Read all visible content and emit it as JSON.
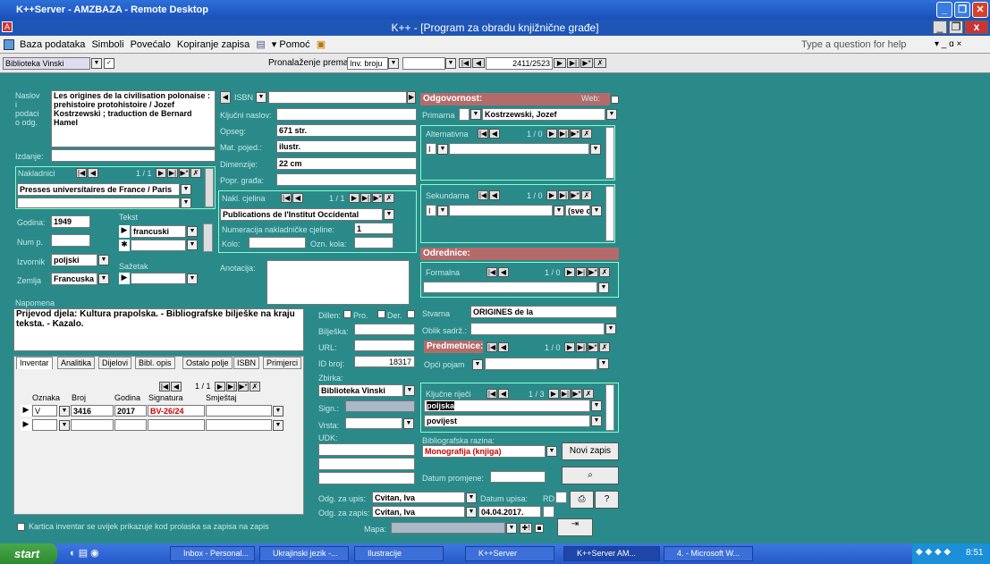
{
  "rdp": {
    "title": "K++Server - AMZBAZA - Remote Desktop"
  },
  "app": {
    "title": "K++ - [Program za obradu knjižnične građe]"
  },
  "menu": {
    "items": [
      "Baza podataka",
      "Simboli",
      "Povećalo",
      "Kopiranje zapisa",
      "▾ Pomoć"
    ],
    "help_placeholder": "Type a question for help"
  },
  "toolbar": {
    "library": "Biblioteka Vinski",
    "search_label": "Pronalaženje prema:",
    "search_by": "Inv. broju",
    "record_counter": "2411/2523"
  },
  "record": {
    "naslov_label": "Naslov i podaci o odg.",
    "naslov": "Les origines de la civilisation polonaise : prehistoire protohistoire / Jozef Kostrzewski ; traduction de Bernard Hamel",
    "izdanje_label": "Izdanje:",
    "nakladnici_label": "Nakladnici",
    "nakladnici_count": "1 / 1",
    "nakladnik": "Presses universitaires de France / Paris",
    "godina_label": "Godina:",
    "godina": "1949",
    "tekst_label": "Tekst",
    "tekst": "francuski",
    "nump_label": "Num p.",
    "izvornik_label": "Izvornik",
    "izvornik": "poljski",
    "sazetak_label": "Sažetak",
    "zemlja_label": "Zemlja",
    "zemlja": "Francuska",
    "napomena_label": "Napomena",
    "napomena": "Prijevod djela: Kultura prapolska. - Bibliografske bilješke na kraju teksta. - Kazalo.",
    "isbn_label": "ISBN",
    "kljucni_naslov_label": "Ključni naslov:",
    "opseg_label": "Opseg:",
    "opseg": "671 str.",
    "mat_label": "Mat. pojed.:",
    "mat": "ilustr.",
    "dimenzije_label": "Dimenzije:",
    "dimenzije": "22 cm",
    "popr_label": "Popr. građa:",
    "nakl_cjelina_label": "Nakl. cjelina",
    "nakl_cjelina_count": "1 / 1",
    "nakl_cjelina": "Publications de l'Institut Occidental",
    "numeracija_label": "Numeracija nakladničke cjeline:",
    "numeracija": "1",
    "kolo_label": "Kolo:",
    "ozn_label": "Ozn. kola:",
    "anotacija_label": "Anotacija:",
    "odgovornost_label": "Odgovornost:",
    "web_label": "Web:",
    "primarna_label": "Primarna",
    "primarna": "Kostrzewski, Jozef",
    "alternativna_label": "Alternativna",
    "alternativna_count": "1 / 0",
    "sekundarna_label": "Sekundarna",
    "sekundarna_count": "1 / 0",
    "sekundarna_role": "(sve o",
    "odrednice_label": "Odrednice:",
    "formalna_label": "Formalna",
    "formalna_count": "1 / 0",
    "stvarna_label": "Stvarna",
    "stvarna": "ORIGINES de la",
    "oblik_label": "Oblik sadrž.:",
    "predmetnice_label": "Predmetnice:",
    "predmetnice_count": "1 / 0",
    "opci_pojam_label": "Opći pojam",
    "kljucne_rijeci_label": "Ključne riječi",
    "kljucne_count": "1 / 3",
    "kljucne_rijeci": [
      "poljska",
      "povijest"
    ],
    "bibl_razina_label": "Bibliografska razina:",
    "bibl_razina": "Monografija (knjiga)",
    "novi_zapis": "Novi zapis",
    "datum_promjene_label": "Datum promjene:",
    "dillen_label": "Dillen:",
    "pro_label": "Pro.",
    "der_label": "Der.",
    "biljeska_label": "Bilješka:",
    "url_label": "URL:",
    "id_label": "ID broj:",
    "id": "18317",
    "zbirka_label": "Zbirka:",
    "zbirka": "Biblioteka Vinski",
    "sign_label": "Sign.:",
    "vrsta_label": "Vrsta:",
    "udk_label": "UDK:",
    "odg_upis_label": "Odg. za upis:",
    "odg_upis": "Cvitan, Iva",
    "datum_upisa_label": "Datum upisa:",
    "rd_label": "RD:",
    "odg_zapis_label": "Odg. za zapis:",
    "odg_zapis": "Cvitan, Iva",
    "datum_upisa": "04.04.2017.",
    "mapa_label": "Mapa:"
  },
  "tabs": [
    "Inventar",
    "Analitika",
    "Dijelovi",
    "Bibl. opis",
    "Ostalo polje",
    "ISBN",
    "Primjerci"
  ],
  "inventar": {
    "count": "1 / 1",
    "headers": [
      "Oznaka",
      "Broj",
      "Godina",
      "Signatura",
      "Smještaj"
    ],
    "rows": [
      {
        "oznaka": "V",
        "broj": "3416",
        "godina": "2017",
        "signatura": "BV-26/24"
      }
    ],
    "checkbox_label": "Kartica inventar se uvijek prikazuje kod prolaska sa zapisa na zapis"
  },
  "taskbar": {
    "start": "start",
    "items": [
      "Inbox - Personal...",
      "Ukrajinski jezik -...",
      "Ilustracije",
      "K++Server",
      "K++Server  AM...",
      "4. - Microsoft W..."
    ],
    "clock": "8:51"
  }
}
